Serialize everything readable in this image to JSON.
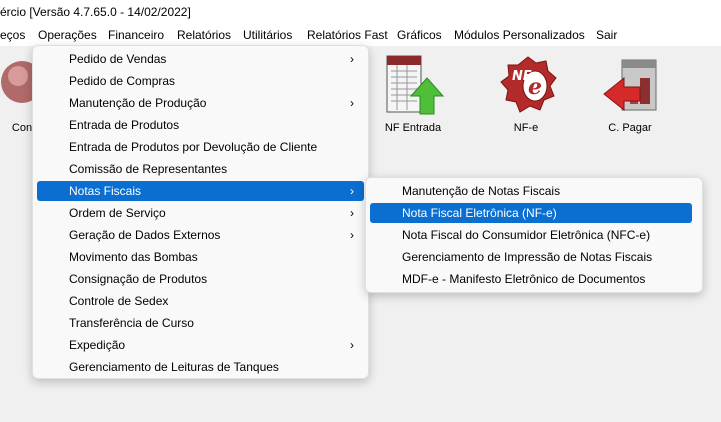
{
  "window": {
    "title": "ércio [Versão 4.7.65.0 - 14/02/2022]"
  },
  "menubar": [
    "eços",
    "Operações",
    "Financeiro",
    "Relatórios",
    "Utilitários",
    "Relatórios Fast",
    "Gráficos",
    "Módulos Personalizados",
    "Sair"
  ],
  "toolbar": {
    "partial_label": "Con",
    "nf_entrada": "NF Entrada",
    "nfe": "NF-e",
    "c_pagar": "C. Pagar",
    "nfe_logo_text": "NF"
  },
  "operacoes_menu": [
    {
      "label": "Pedido de Vendas",
      "submenu": true
    },
    {
      "label": "Pedido de Compras",
      "submenu": false
    },
    {
      "label": "Manutenção de Produção",
      "submenu": true
    },
    {
      "label": "Entrada de Produtos",
      "submenu": false
    },
    {
      "label": "Entrada de Produtos por Devolução de Cliente",
      "submenu": false
    },
    {
      "label": "Comissão de Representantes",
      "submenu": false
    },
    {
      "label": "Notas Fiscais",
      "submenu": true,
      "selected": true
    },
    {
      "label": "Ordem de Serviço",
      "submenu": true
    },
    {
      "label": "Geração de Dados Externos",
      "submenu": true
    },
    {
      "label": "Movimento das Bombas",
      "submenu": false
    },
    {
      "label": "Consignação de Produtos",
      "submenu": false
    },
    {
      "label": "Controle de Sedex",
      "submenu": false
    },
    {
      "label": "Transferência de Curso",
      "submenu": false
    },
    {
      "label": "Expedição",
      "submenu": true
    },
    {
      "label": "Gerenciamento de Leituras de Tanques",
      "submenu": false
    }
  ],
  "notas_fiscais_submenu": [
    {
      "label": "Manutenção de Notas Fiscais"
    },
    {
      "label": "Nota Fiscal Eletrônica (NF-e)",
      "selected": true
    },
    {
      "label": "Nota Fiscal do Consumidor Eletrônica (NFC-e)"
    },
    {
      "label": "Gerenciamento de Impressão de Notas Fiscais"
    },
    {
      "label": "MDF-e - Manifesto Eletrônico de Documentos"
    }
  ],
  "colors": {
    "selection": "#0a6fd1",
    "menu_bg": "#f9f9f9",
    "workspace_bg": "#f0f0f0"
  },
  "submenu_arrow": "›"
}
